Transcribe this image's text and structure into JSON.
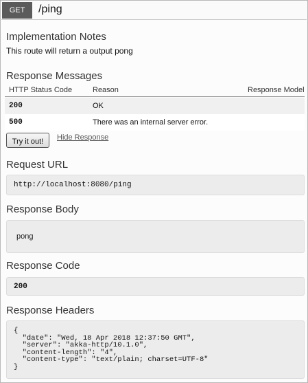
{
  "operation": {
    "method": "GET",
    "path": "/ping"
  },
  "implementation_notes": {
    "title": "Implementation Notes",
    "text": "This route will return a output pong"
  },
  "response_messages": {
    "title": "Response Messages",
    "columns": [
      "HTTP Status Code",
      "Reason",
      "Response Model"
    ],
    "rows": [
      {
        "code": "200",
        "reason": "OK"
      },
      {
        "code": "500",
        "reason": "There was an internal server error."
      }
    ]
  },
  "actions": {
    "try_label": "Try it out!",
    "hide_label": "Hide Response"
  },
  "request_url": {
    "title": "Request URL",
    "value": "http://localhost:8080/ping"
  },
  "response_body": {
    "title": "Response Body",
    "value": "pong"
  },
  "response_code": {
    "title": "Response Code",
    "value": "200"
  },
  "response_headers": {
    "title": "Response Headers",
    "text": "{\n  \"date\": \"Wed, 18 Apr 2018 12:37:50 GMT\",\n  \"server\": \"akka-http/10.1.0\",\n  \"content-length\": \"4\",\n  \"content-type\": \"text/plain; charset=UTF-8\"\n}"
  }
}
